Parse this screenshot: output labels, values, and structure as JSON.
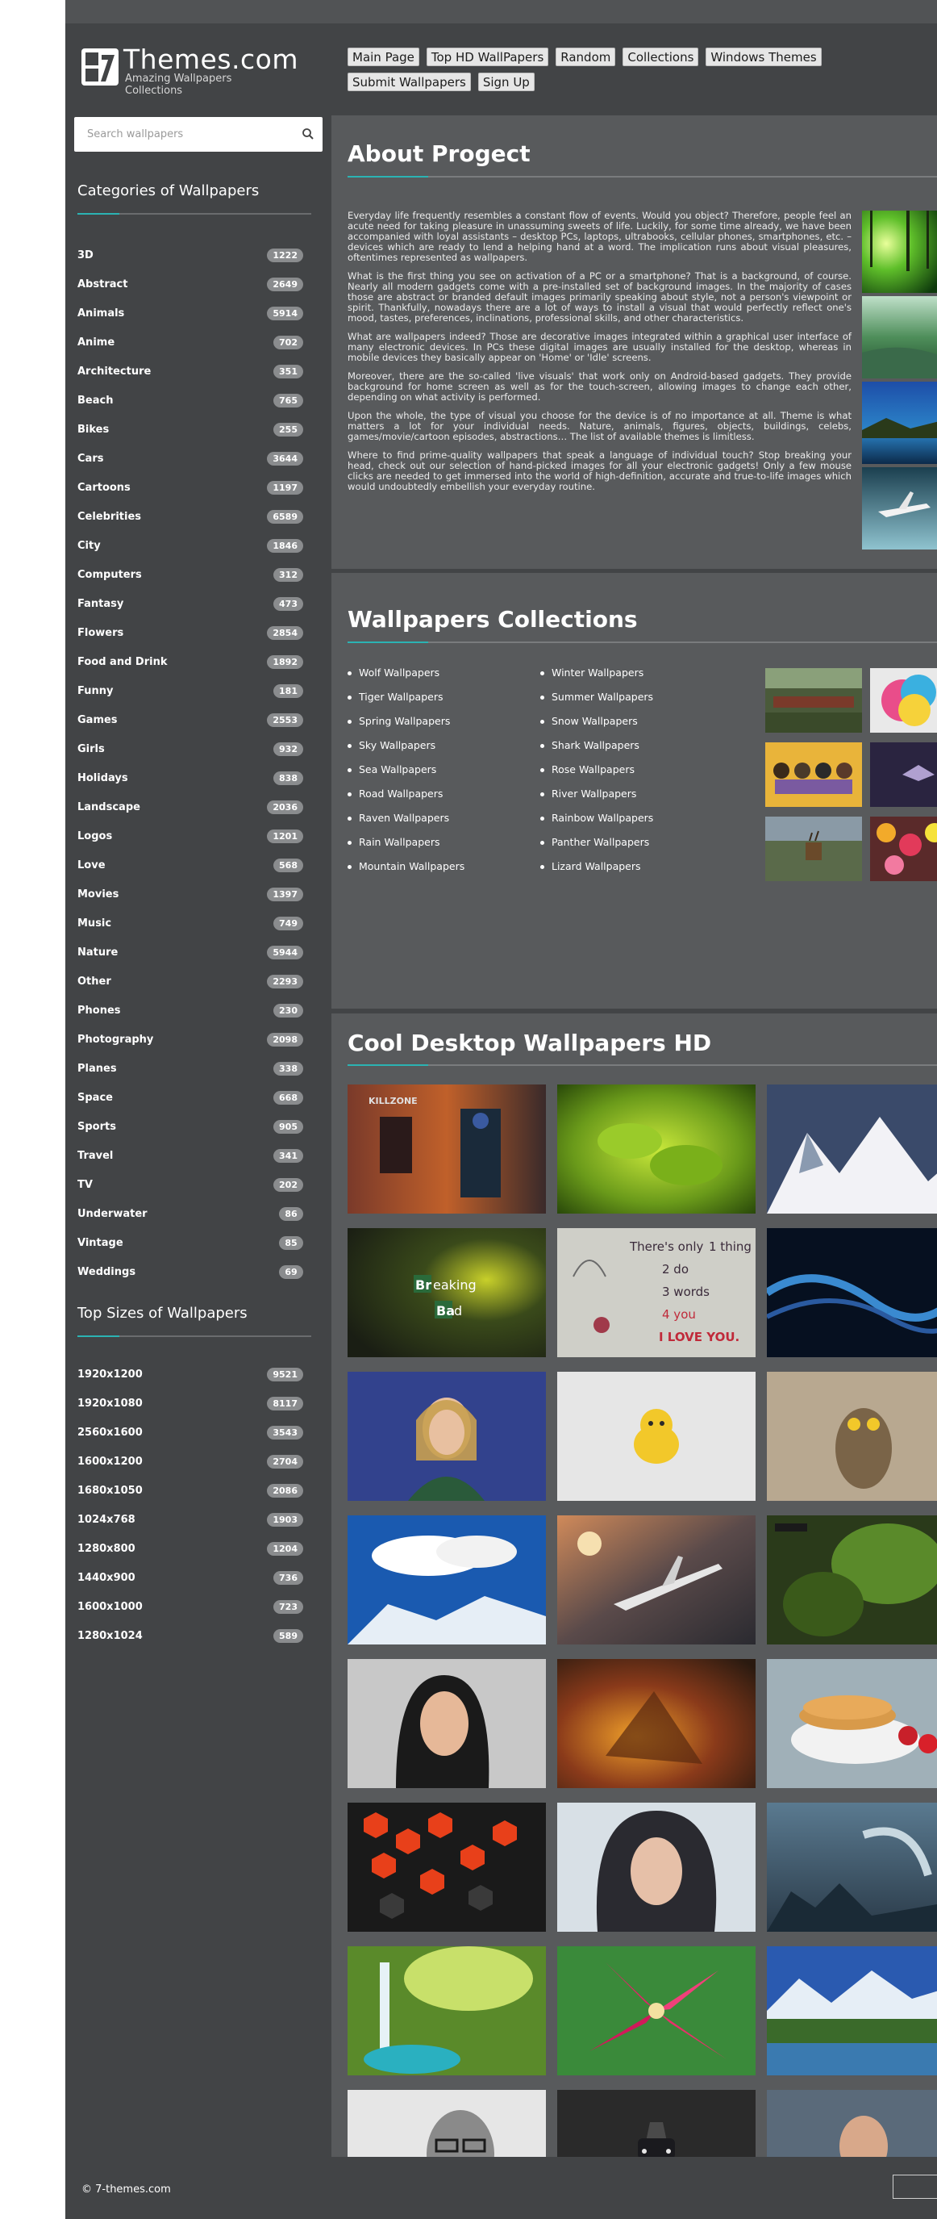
{
  "site": {
    "name": "Themes.com",
    "tagline": "Amazing Wallpapers Collections"
  },
  "nav": {
    "row1": [
      "Main Page",
      "Top HD WallPapers",
      "Random",
      "Collections",
      "Windows Themes"
    ],
    "row2": [
      "Submit Wallpapers",
      "Sign Up"
    ]
  },
  "search": {
    "placeholder": "Search wallpapers"
  },
  "sidebar": {
    "categories_title": "Categories of Wallpapers",
    "categories": [
      {
        "label": "3D",
        "count": "1222"
      },
      {
        "label": "Abstract",
        "count": "2649"
      },
      {
        "label": "Animals",
        "count": "5914"
      },
      {
        "label": "Anime",
        "count": "702"
      },
      {
        "label": "Architecture",
        "count": "351"
      },
      {
        "label": "Beach",
        "count": "765"
      },
      {
        "label": "Bikes",
        "count": "255"
      },
      {
        "label": "Cars",
        "count": "3644"
      },
      {
        "label": "Cartoons",
        "count": "1197"
      },
      {
        "label": "Celebrities",
        "count": "6589"
      },
      {
        "label": "City",
        "count": "1846"
      },
      {
        "label": "Computers",
        "count": "312"
      },
      {
        "label": "Fantasy",
        "count": "473"
      },
      {
        "label": "Flowers",
        "count": "2854"
      },
      {
        "label": "Food and Drink",
        "count": "1892"
      },
      {
        "label": "Funny",
        "count": "181"
      },
      {
        "label": "Games",
        "count": "2553"
      },
      {
        "label": "Girls",
        "count": "932"
      },
      {
        "label": "Holidays",
        "count": "838"
      },
      {
        "label": "Landscape",
        "count": "2036"
      },
      {
        "label": "Logos",
        "count": "1201"
      },
      {
        "label": "Love",
        "count": "568"
      },
      {
        "label": "Movies",
        "count": "1397"
      },
      {
        "label": "Music",
        "count": "749"
      },
      {
        "label": "Nature",
        "count": "5944"
      },
      {
        "label": "Other",
        "count": "2293"
      },
      {
        "label": "Phones",
        "count": "230"
      },
      {
        "label": "Photography",
        "count": "2098"
      },
      {
        "label": "Planes",
        "count": "338"
      },
      {
        "label": "Space",
        "count": "668"
      },
      {
        "label": "Sports",
        "count": "905"
      },
      {
        "label": "Travel",
        "count": "341"
      },
      {
        "label": "TV",
        "count": "202"
      },
      {
        "label": "Underwater",
        "count": "86"
      },
      {
        "label": "Vintage",
        "count": "85"
      },
      {
        "label": "Weddings",
        "count": "69"
      }
    ],
    "sizes_title": "Top Sizes of Wallpapers",
    "sizes": [
      {
        "label": "1920x1200",
        "count": "9521"
      },
      {
        "label": "1920x1080",
        "count": "8117"
      },
      {
        "label": "2560x1600",
        "count": "3543"
      },
      {
        "label": "1600x1200",
        "count": "2704"
      },
      {
        "label": "1680x1050",
        "count": "2086"
      },
      {
        "label": "1024x768",
        "count": "1903"
      },
      {
        "label": "1280x800",
        "count": "1204"
      },
      {
        "label": "1440x900",
        "count": "736"
      },
      {
        "label": "1600x1000",
        "count": "723"
      },
      {
        "label": "1280x1024",
        "count": "589"
      }
    ]
  },
  "about": {
    "title": "About Progect",
    "paragraphs": [
      "Everyday life frequently resembles a constant flow of events. Would you object? Therefore, people feel an acute need for taking pleasure in unassuming sweets of life. Luckily, for some time already, we have been accompanied with loyal assistants – desktop PCs, laptops, ultrabooks, cellular phones, smartphones, etc. – devices which are ready to lend a helping hand at a word. The implication runs about visual pleasures, oftentimes represented as wallpapers.",
      "What is the first thing you see on activation of a PC or a smartphone? That is a background, of course. Nearly all modern gadgets come with a pre-installed set of background images. In the majority of cases those are abstract or branded default images primarily speaking about style, not a person's viewpoint or spirit. Thankfully, nowadays there are a lot of ways to install a visual that would perfectly reflect one's mood, tastes, preferences, inclinations, professional skills, and other characteristics.",
      "What are wallpapers indeed? Those are decorative images integrated within a graphical user interface of many electronic devices. In PCs these digital images are usually installed for the desktop, whereas in mobile devices they basically appear on 'Home' or 'Idle' screens.",
      "Moreover, there are the so-called 'live visuals' that work only on Android-based gadgets. They provide background for home screen as well as for the touch-screen, allowing images to change each other, depending on what activity is performed.",
      "Upon the whole, the type of visual you choose for the device is of no importance at all. Theme is what matters a lot for your individual needs. Nature, animals, figures, objects, buildings, celebs, games/movie/cartoon episodes, abstractions… The list of available themes is limitless.",
      "Where to find prime-quality wallpapers that speak a language of individual touch? Stop breaking your head, check out our selection of hand-picked images for all your electronic gadgets! Only a few mouse clicks are needed to get immersed into the world of high-definition, accurate and true-to-life images which would undoubtedly embellish your everyday routine."
    ]
  },
  "collections": {
    "title": "Wallpapers Collections",
    "col1": [
      "Wolf Wallpapers",
      "Tiger Wallpapers",
      "Spring Wallpapers",
      "Sky Wallpapers",
      "Sea Wallpapers",
      "Road Wallpapers",
      "Raven Wallpapers",
      "Rain Wallpapers",
      "Mountain Wallpapers"
    ],
    "col2": [
      "Winter Wallpapers",
      "Summer Wallpapers",
      "Snow Wallpapers",
      "Shark Wallpapers",
      "Rose Wallpapers",
      "River Wallpapers",
      "Rainbow Wallpapers",
      "Panther Wallpapers",
      "Lizard Wallpapers"
    ]
  },
  "cool": {
    "title": "Cool Desktop Wallpapers HD",
    "thumb_text": {
      "killzone": "KILLZONE",
      "breaking1": "Br",
      "breaking2": "eaking",
      "breaking3": "Ba",
      "breaking4": "d",
      "note1": "There's only",
      "note2": "1 thing",
      "note3": "2 do",
      "note4": "3 words",
      "note5": "4 you",
      "note6": "I LOVE YOU."
    }
  },
  "footer": {
    "copyright": "© 7-themes.com"
  },
  "colors": {
    "accent": "#2bb3b3",
    "page_bg": "#424446",
    "panel_bg": "#585a5c"
  }
}
